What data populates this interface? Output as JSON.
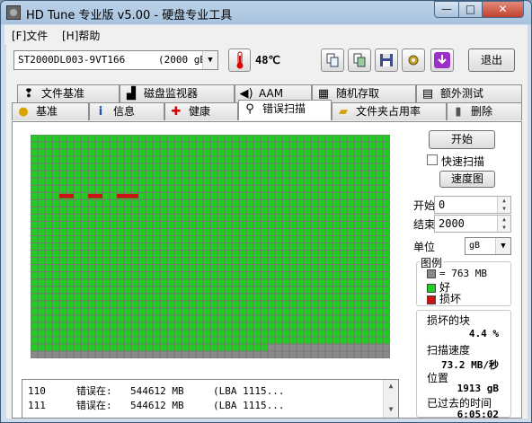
{
  "window": {
    "title": "HD Tune 专业版 v5.00 - 硬盘专业工具",
    "minimize": "—",
    "maximize": "□",
    "close": "✕"
  },
  "menu": [
    {
      "label": "[F]文件"
    },
    {
      "label": "[H]帮助"
    }
  ],
  "toolbar": {
    "drive": "ST2000DL003-9VT166",
    "drive_size": "(2000 gB)",
    "temperature": "48℃",
    "icons": [
      "copy-text-icon",
      "copy-screen-icon",
      "save-icon",
      "options-icon",
      "download-icon"
    ],
    "exit_label": "退出"
  },
  "tabs_top": [
    "文件基准",
    "磁盘监视器",
    "AAM",
    "随机存取",
    "额外测试"
  ],
  "tabs_bottom": [
    "基准",
    "信息",
    "健康",
    "错误扫描",
    "文件夹占用率",
    "删除"
  ],
  "active_tab": "错误扫描",
  "scan": {
    "cols": 50,
    "rows": 31,
    "total_blocks": 1550,
    "scanned_blocks": 1483,
    "bad_blocks": [
      {
        "row": 8,
        "col": 4
      },
      {
        "row": 8,
        "col": 5
      },
      {
        "row": 8,
        "col": 8
      },
      {
        "row": 8,
        "col": 9
      },
      {
        "row": 8,
        "col": 12
      },
      {
        "row": 8,
        "col": 13
      },
      {
        "row": 8,
        "col": 14
      }
    ],
    "colors": {
      "good": "#22cc22",
      "bad": "#cc1111",
      "unscanned": "#8a8a8a",
      "grid": "#777777"
    }
  },
  "log": [
    {
      "id": "110",
      "label": "错误在:",
      "size": "544612 MB",
      "lba": "(LBA 1115..."
    },
    {
      "id": "111",
      "label": "错误在:",
      "size": "544612 MB",
      "lba": "(LBA 1115..."
    }
  ],
  "controls": {
    "start_button": "开始",
    "quick_scan_label": "快速扫描",
    "quick_scan_checked": false,
    "speed_map_button": "速度图",
    "start_label": "开始",
    "start_value": "0",
    "end_label": "结束",
    "end_value": "2000",
    "unit_label": "单位",
    "unit_value": "gB"
  },
  "legend": {
    "title": "图例",
    "block_size": "= 763 MB",
    "good": "好",
    "bad": "损坏"
  },
  "stats": {
    "damaged_label": "损坏的块",
    "damaged_value": "4.4 %",
    "speed_label": "扫描速度",
    "speed_value": "73.2 MB/秒",
    "position_label": "位置",
    "position_value": "1913 gB",
    "elapsed_label": "已过去的时间",
    "elapsed_value": "6:05:02"
  }
}
